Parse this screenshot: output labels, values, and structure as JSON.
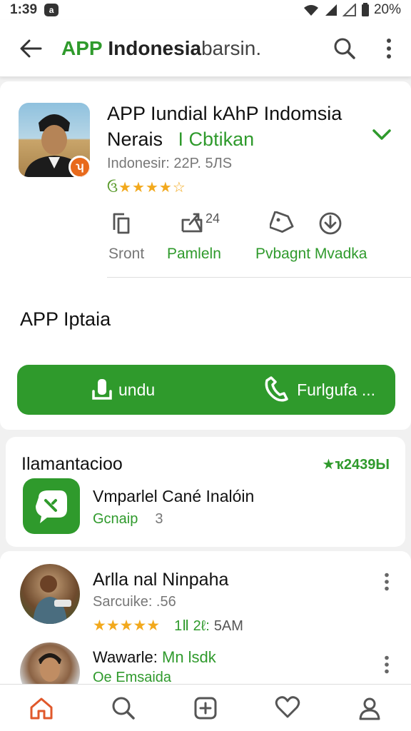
{
  "status_bar": {
    "time": "1:39",
    "notification_glyph": "a",
    "battery": "20%"
  },
  "appbar": {
    "title_brand": "APP",
    "title_rest": "Indonesia",
    "title_tail": "barsin."
  },
  "app": {
    "title": "APP Iundial kAhP Indomsia",
    "line2_a": "Nerais",
    "line2_b": "I Cbtikan",
    "meta": "Indonesir: 22P. 5ЛS",
    "stars_text": "★★★★",
    "star_first": "ઉ",
    "star_empty": "☆",
    "badge": "ʮ"
  },
  "actions": {
    "a1_label": "Sront",
    "a2_label": "Pamleln",
    "a2_count": "24",
    "a3_label": "Pvbagnt Mvadka"
  },
  "section": {
    "title": "APP Iptaia"
  },
  "cta": {
    "left_label": "undu",
    "right_label": "Furlgufa ..."
  },
  "card_two": {
    "title": "Ilamantacioo",
    "rating": "★ҡ2439Ы",
    "name": "Vmparlel Cané Inalóin",
    "sub_green": "Gcnaip",
    "sub_count": "3"
  },
  "reviews": [
    {
      "name": "Arlla nal Ninpaha",
      "sub": "Sarcuike: .56",
      "stars": "★★★★★",
      "meta": "1Ⅱ 2ℓ:",
      "meta2": "5AM"
    },
    {
      "name_a": "Wawarle:",
      "name_b": "Mn lsdk",
      "sub": "Oe Emsaida"
    }
  ],
  "colors": {
    "accent": "#2f9a2c",
    "star": "#f2a91d",
    "badge": "#e86a1c"
  }
}
